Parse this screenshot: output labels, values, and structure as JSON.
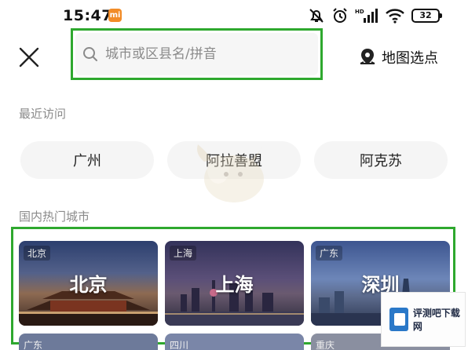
{
  "status_bar": {
    "time": "15:47",
    "carrier_badge": "mi",
    "battery": "32",
    "icons": [
      "mute-bell-icon",
      "alarm-icon",
      "hd-signal-icon",
      "wifi-icon",
      "battery-icon"
    ]
  },
  "header": {
    "close_icon": "close-icon",
    "search_placeholder": "城市或区县名/拼音",
    "map_pick_label": "地图选点",
    "map_pick_icon": "map-pin-icon"
  },
  "recent": {
    "title": "最近访问",
    "items": [
      "广州",
      "阿拉善盟",
      "阿克苏"
    ]
  },
  "hot": {
    "title": "国内热门城市",
    "cards": [
      {
        "region": "北京",
        "city": "北京"
      },
      {
        "region": "上海",
        "city": "上海"
      },
      {
        "region": "广东",
        "city": "深圳"
      }
    ],
    "next_row_regions": [
      "广东",
      "四川",
      "重庆"
    ]
  },
  "watermark": {
    "text": "评测吧下载网"
  },
  "colors": {
    "highlight": "#2ea82e",
    "chip_bg": "#f5f5f5"
  }
}
